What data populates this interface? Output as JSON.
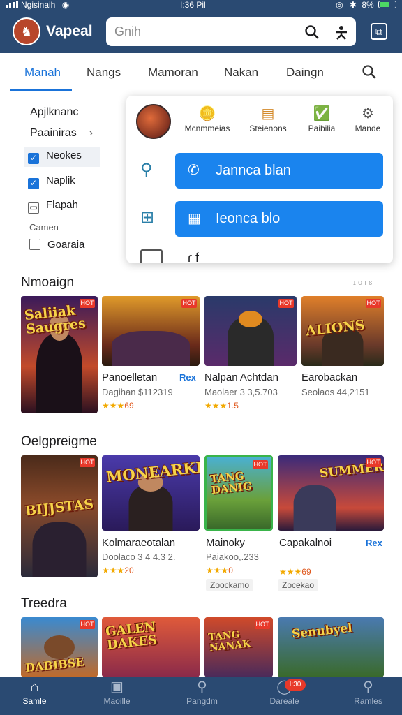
{
  "status_bar": {
    "carrier": "Ngisinaih",
    "time": "I:36 Pil",
    "battery_pct": "8%"
  },
  "header": {
    "app_name": "Vapeal",
    "search_placeholder": "Gnih"
  },
  "tabs": [
    "Manah",
    "Nangs",
    "Mamoran",
    "Nakan",
    "Daingn"
  ],
  "sidebar": {
    "title": "Apjlknanc",
    "subtitle": "Paainiras",
    "items": [
      {
        "label": "Neokes",
        "checked": true
      },
      {
        "label": "Naplik",
        "checked": true
      },
      {
        "label": "Flapah",
        "checked": false
      }
    ],
    "group_label": "Camen",
    "group_items": [
      {
        "label": "Goaraia",
        "checked": false
      }
    ]
  },
  "popup": {
    "items": [
      "Mcnmmeias",
      "Steienons",
      "Paibilia",
      "Mande"
    ],
    "buttons": [
      "Jannca blan",
      "Ieonca blo"
    ],
    "cut_text": "ɾ f"
  },
  "sections": [
    {
      "title": "Nmoaign",
      "more": "ɪ o ı ɛ",
      "cards": [
        {
          "art_text": "Saliiak Saugres",
          "name": "Panoelletan",
          "sub": "Dagihan $112319",
          "stars": "★★★",
          "rating": "69",
          "tag": "Rex"
        },
        {
          "art_text": "",
          "name": "",
          "sub": "",
          "stars": "",
          "rating": "",
          "tag": ""
        },
        {
          "art_text": "",
          "name": "Nalpan Achtdan",
          "sub": "Maolaer 3 3,5.703",
          "stars": "★★★",
          "rating": "1.5",
          "tag": ""
        },
        {
          "art_text": "ALIONS",
          "name": "Earobackan",
          "sub": "Seolaos 44,2151",
          "stars": "",
          "rating": "",
          "tag": ""
        }
      ]
    },
    {
      "title": "Oelgpreigme",
      "more": "",
      "cards": [
        {
          "art_text": "BIJJSTAS",
          "name": "Kolmaraeotalan",
          "sub": "Doolaco 3 4 4.3 2.",
          "stars": "★★★",
          "rating": "20",
          "tag": ""
        },
        {
          "art_text": "MONEARKK",
          "name": "",
          "sub": "",
          "stars": "",
          "rating": "",
          "tag": ""
        },
        {
          "art_text": "TANG DANIG",
          "name": "Mainoky",
          "sub": "Paiakoo,.233",
          "stars": "★★★",
          "rating": "0",
          "tag": "",
          "chip": "Zoockamo"
        },
        {
          "art_text": "SUMMER",
          "name": "Capakalnoi",
          "sub": "",
          "stars": "★★★",
          "rating": "69",
          "tag": "Rex",
          "chip": "Zocekao"
        }
      ]
    },
    {
      "title": "Treedra",
      "more": "",
      "cards": [
        {
          "art_text": "DABIBSE"
        },
        {
          "art_text": "GALEN DAKES"
        },
        {
          "art_text": "TANG NANAK"
        },
        {
          "art_text": "Senubyel"
        }
      ]
    }
  ],
  "bottom_nav": [
    "Samle",
    "Maoille",
    "Pangdm",
    "Dareale",
    "Ramles"
  ],
  "bottom_nav_badge": "I:30",
  "colors": {
    "header": "#2a4a72",
    "accent": "#1a73d9",
    "button": "#1a84ee",
    "badge": "#e8392a",
    "star": "#f2a900"
  },
  "icons": {
    "popup_items": [
      "coin-icon",
      "box-icon",
      "chart-icon",
      "gear-icon"
    ],
    "popup_side": [
      "key-icon",
      "grid-icon",
      "window-icon"
    ],
    "bottom_nav": [
      "home-icon",
      "game-icon",
      "search-icon",
      "chat-icon",
      "search-icon"
    ]
  }
}
